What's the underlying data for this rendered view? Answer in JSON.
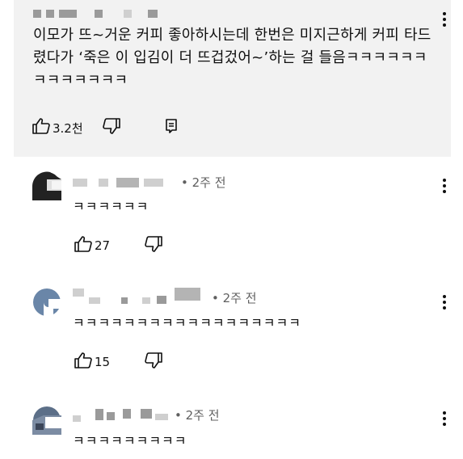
{
  "top_comment": {
    "text": "이모가 뜨~거운 커피 좋아하시는데 한번은 미지근하게 커피 타드렸다가 ‘죽은 이 입김이 더 뜨겁겄어~’하는 걸 들음ㅋㅋㅋㅋㅋㅋㅋㅋㅋㅋㅋㅋㅋ",
    "like_count": "3.2천"
  },
  "replies": [
    {
      "time": "• 2주 전",
      "text": "ㅋㅋㅋㅋㅋㅋ",
      "like_count": "27"
    },
    {
      "time": "• 2주 전",
      "text": "ㅋㅋㅋㅋㅋㅋㅋㅋㅋㅋㅋㅋㅋㅋㅋㅋㅋㅋ",
      "like_count": "15"
    },
    {
      "time": "• 2주 전",
      "text": "ㅋㅋㅋㅋㅋㅋㅋㅋㅋ"
    }
  ],
  "icons": {
    "like": "thumbs-up-icon",
    "dislike": "thumbs-down-icon",
    "reply": "reply-icon",
    "more": "more-vert-icon"
  }
}
